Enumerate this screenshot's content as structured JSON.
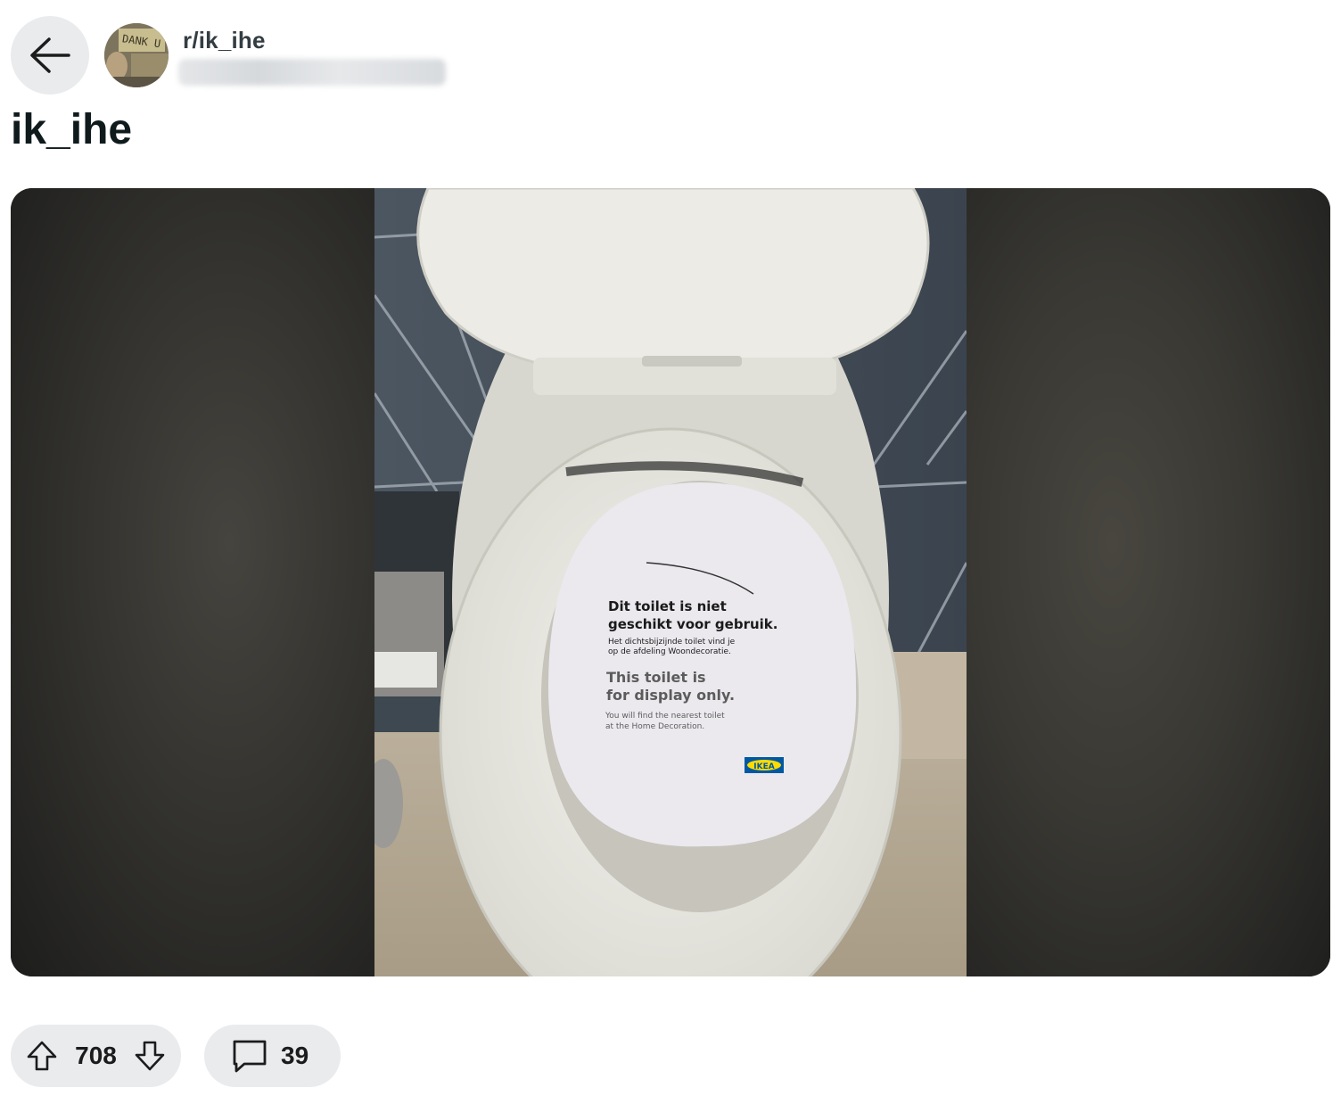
{
  "header": {
    "subreddit": "r/ik_ihe",
    "username_hidden": true,
    "back_icon": "arrow-left-icon",
    "avatar_text": "DANK U"
  },
  "post": {
    "title": "ik_ihe",
    "image": {
      "sign_nl_heading_1": "Dit toilet is niet",
      "sign_nl_heading_2": "geschikt voor gebruik.",
      "sign_nl_body_1": "Het dichtsbijzijnde toilet vind je",
      "sign_nl_body_2": "op de afdeling Woondecoratie.",
      "sign_en_heading_1": "This toilet is",
      "sign_en_heading_2": "for display only.",
      "sign_en_body_1": "You will find the nearest toilet",
      "sign_en_body_2": "at the Home Decoration.",
      "logo_text": "IKEA"
    }
  },
  "actions": {
    "upvotes": "708",
    "comments": "39",
    "upvote_icon": "arrow-up-icon",
    "downvote_icon": "arrow-down-icon",
    "comment_icon": "comment-bubble-icon"
  },
  "colors": {
    "pill_bg": "#e9ebed",
    "title": "#0f1a1c",
    "subreddit": "#333d42",
    "ikea_blue": "#0058a3",
    "ikea_yellow": "#ffdb00"
  }
}
